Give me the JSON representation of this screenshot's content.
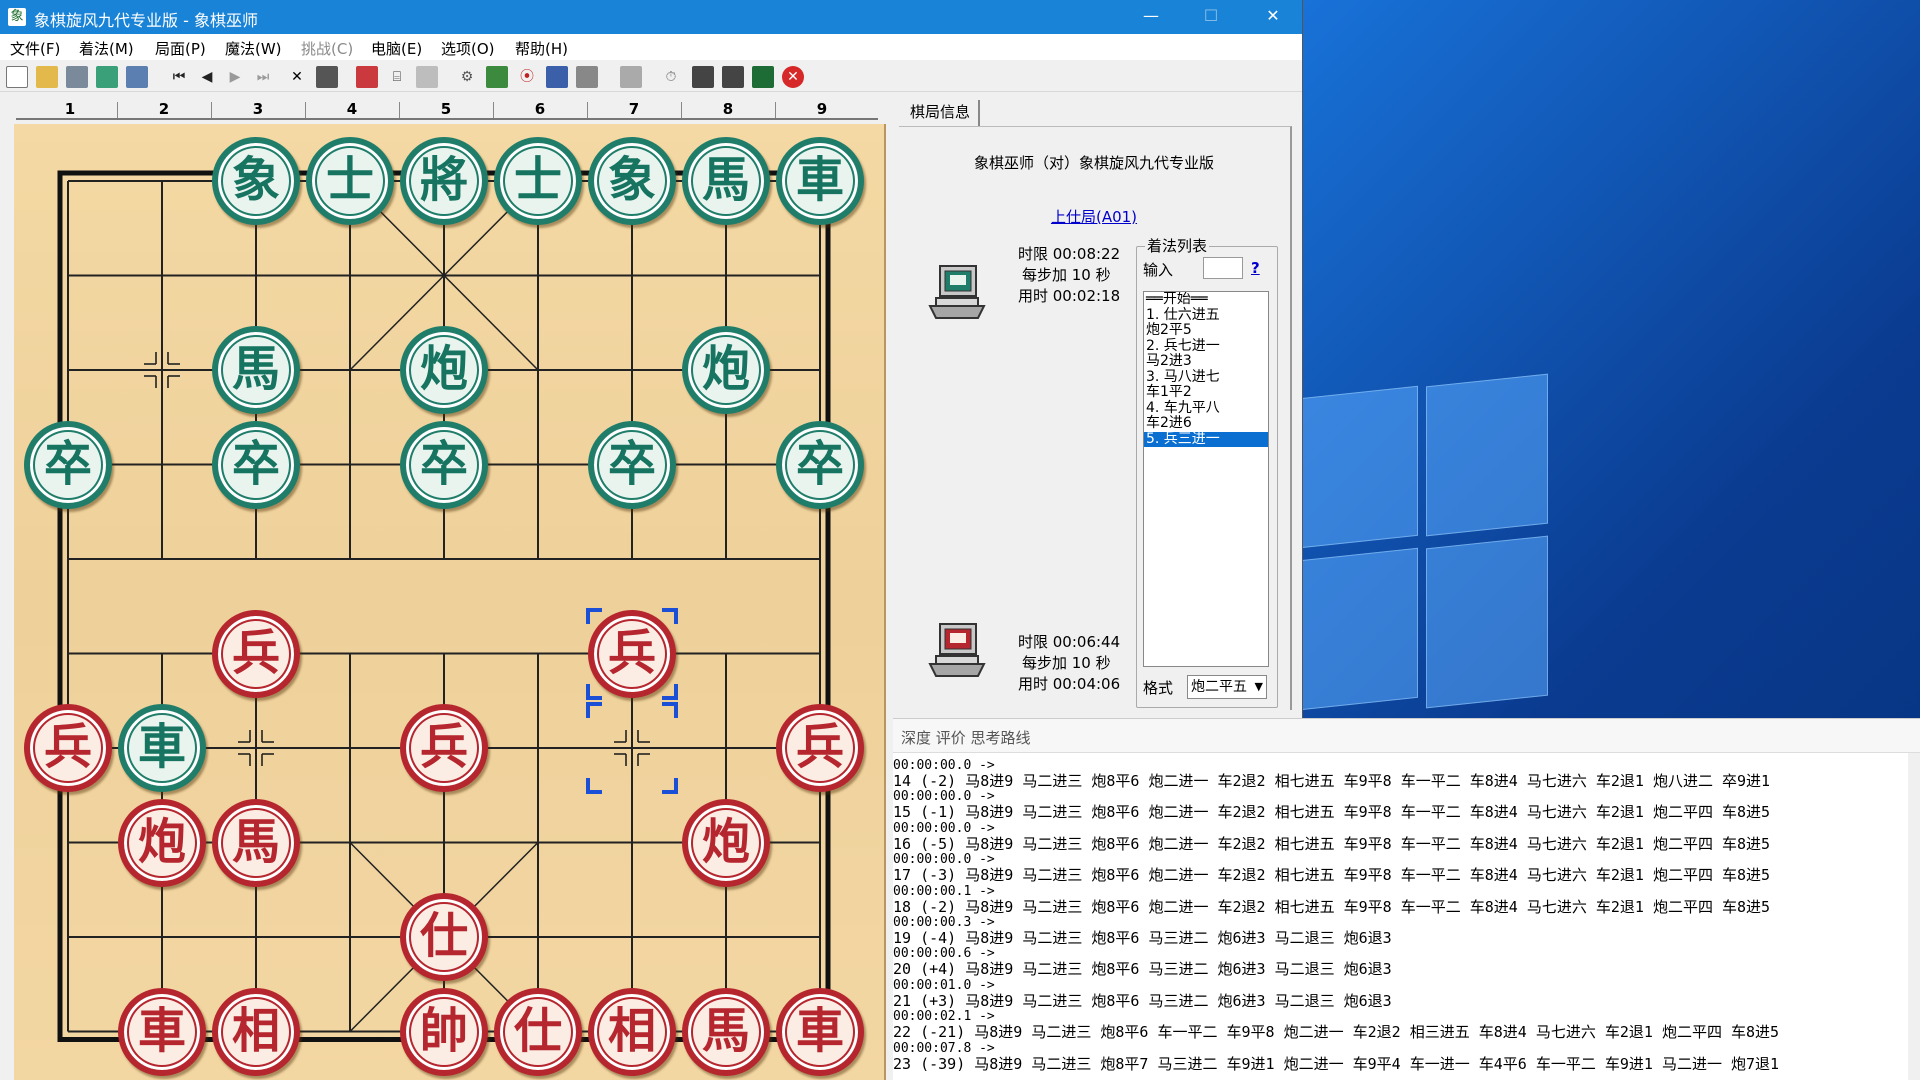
{
  "window": {
    "title": "象棋旋风九代专业版 - 象棋巫师",
    "app_icon_glyph": "象",
    "min_label": "—",
    "max_label": "☐",
    "close_label": "✕"
  },
  "menu": [
    {
      "label": "文件(F)",
      "enabled": true
    },
    {
      "label": "着法(M)",
      "enabled": true
    },
    {
      "label": "局面(P)",
      "enabled": true
    },
    {
      "label": "魔法(W)",
      "enabled": true
    },
    {
      "label": "挑战(C)",
      "enabled": false
    },
    {
      "label": "电脑(E)",
      "enabled": true
    },
    {
      "label": "选项(O)",
      "enabled": true
    },
    {
      "label": "帮助(H)",
      "enabled": true
    }
  ],
  "toolbar_icons": [
    "new-file-icon",
    "open-folder-icon",
    "save-icon",
    "save-as-icon",
    "print-icon",
    "first-move-icon",
    "previous-move-icon",
    "next-move-icon",
    "last-move-icon",
    "delete-move-icon",
    "paste-icon",
    "flip-board-icon",
    "tree-icon",
    "grid-icon",
    "engine-settings-icon",
    "engine-load-icon",
    "analyze-icon",
    "book-icon",
    "batch-icon",
    "library-icon",
    "timer-icon",
    "computer-black-icon",
    "computer-red-icon",
    "chart-icon",
    "stop-icon"
  ],
  "ruler_numbers": [
    "1",
    "2",
    "3",
    "4",
    "5",
    "6",
    "7",
    "8",
    "9"
  ],
  "pieces": [
    {
      "side": "black",
      "char": "象",
      "file": 2,
      "rank": 0
    },
    {
      "side": "black",
      "char": "士",
      "file": 3,
      "rank": 0
    },
    {
      "side": "black",
      "char": "將",
      "file": 4,
      "rank": 0
    },
    {
      "side": "black",
      "char": "士",
      "file": 5,
      "rank": 0
    },
    {
      "side": "black",
      "char": "象",
      "file": 6,
      "rank": 0
    },
    {
      "side": "black",
      "char": "馬",
      "file": 7,
      "rank": 0
    },
    {
      "side": "black",
      "char": "車",
      "file": 8,
      "rank": 0
    },
    {
      "side": "black",
      "char": "馬",
      "file": 2,
      "rank": 2
    },
    {
      "side": "black",
      "char": "炮",
      "file": 4,
      "rank": 2
    },
    {
      "side": "black",
      "char": "炮",
      "file": 7,
      "rank": 2
    },
    {
      "side": "black",
      "char": "卒",
      "file": 0,
      "rank": 3
    },
    {
      "side": "black",
      "char": "卒",
      "file": 2,
      "rank": 3
    },
    {
      "side": "black",
      "char": "卒",
      "file": 4,
      "rank": 3
    },
    {
      "side": "black",
      "char": "卒",
      "file": 6,
      "rank": 3
    },
    {
      "side": "black",
      "char": "卒",
      "file": 8,
      "rank": 3
    },
    {
      "side": "black",
      "char": "車",
      "file": 1,
      "rank": 6
    },
    {
      "side": "red",
      "char": "兵",
      "file": 2,
      "rank": 5
    },
    {
      "side": "red",
      "char": "兵",
      "file": 6,
      "rank": 5
    },
    {
      "side": "red",
      "char": "兵",
      "file": 0,
      "rank": 6
    },
    {
      "side": "red",
      "char": "兵",
      "file": 4,
      "rank": 6
    },
    {
      "side": "red",
      "char": "兵",
      "file": 8,
      "rank": 6
    },
    {
      "side": "red",
      "char": "炮",
      "file": 1,
      "rank": 7
    },
    {
      "side": "red",
      "char": "馬",
      "file": 2,
      "rank": 7
    },
    {
      "side": "red",
      "char": "炮",
      "file": 7,
      "rank": 7
    },
    {
      "side": "red",
      "char": "仕",
      "file": 4,
      "rank": 8
    },
    {
      "side": "red",
      "char": "車",
      "file": 1,
      "rank": 9
    },
    {
      "side": "red",
      "char": "相",
      "file": 2,
      "rank": 9
    },
    {
      "side": "red",
      "char": "帥",
      "file": 4,
      "rank": 9
    },
    {
      "side": "red",
      "char": "仕",
      "file": 5,
      "rank": 9
    },
    {
      "side": "red",
      "char": "相",
      "file": 6,
      "rank": 9
    },
    {
      "side": "red",
      "char": "馬",
      "file": 7,
      "rank": 9
    },
    {
      "side": "red",
      "char": "車",
      "file": 8,
      "rank": 9
    }
  ],
  "last_move": {
    "from": {
      "file": 6,
      "rank": 6
    },
    "to": {
      "file": 6,
      "rank": 5
    }
  },
  "info": {
    "tab_label": "棋局信息",
    "match_title": "象棋巫师（对）象棋旋风九代专业版",
    "opening": "上仕局(A01)",
    "black_clock": {
      "limit": "时限  00:08:22",
      "increment": "每步加  10  秒",
      "used": "用时  00:02:18"
    },
    "red_clock": {
      "limit": "时限  00:06:44",
      "increment": "每步加  10  秒",
      "used": "用时  00:04:06"
    },
    "movelist_title": "着法列表",
    "input_label": "输入",
    "input_value": "",
    "help_label": "?",
    "moves": [
      "══开始══",
      "1. 仕六进五",
      "   炮2平5",
      "2. 兵七进一",
      "   马2进3",
      "3. 马八进七",
      "   车1平2",
      "4. 车九平八",
      "   车2进6",
      "5. 兵三进一"
    ],
    "selected_move_index": 9,
    "format_label": "格式",
    "format_value": "炮二平五"
  },
  "analysis": {
    "header": "深度  评价  思考路线",
    "lines": [
      {
        "time": "00:00:00.0 ->",
        "main": " 14    (-2) 马8进9  马二进三  炮8平6  炮二进一  车2退2  相七进五  车9平8  车一平二  车8进4  马七进六  车2退1  炮八进二  卒9进1"
      },
      {
        "time": "00:00:00.0 ->",
        "main": " 15    (-1) 马8进9  马二进三  炮8平6  炮二进一  车2退2  相七进五  车9平8  车一平二  车8进4  马七进六  车2退1  炮二平四  车8进5"
      },
      {
        "time": "00:00:00.0 ->",
        "main": " 16    (-5) 马8进9  马二进三  炮8平6  炮二进一  车2退2  相七进五  车9平8  车一平二  车8进4  马七进六  车2退1  炮二平四  车8进5"
      },
      {
        "time": "00:00:00.0 ->",
        "main": " 17    (-3) 马8进9  马二进三  炮8平6  炮二进一  车2退2  相七进五  车9平8  车一平二  车8进4  马七进六  车2退1  炮二平四  车8进5"
      },
      {
        "time": "00:00:00.1 ->",
        "main": " 18    (-2) 马8进9  马二进三  炮8平6  炮二进一  车2退2  相七进五  车9平8  车一平二  车8进4  马七进六  车2退1  炮二平四  车8进5"
      },
      {
        "time": "00:00:00.3 ->",
        "main": " 19    (-4) 马8进9  马二进三  炮8平6  马三进二  炮6进3  马二退三  炮6退3"
      },
      {
        "time": "00:00:00.6 ->",
        "main": " 20    (+4) 马8进9  马二进三  炮8平6  马三进二  炮6进3  马二退三  炮6退3"
      },
      {
        "time": "00:00:01.0 ->",
        "main": " 21    (+3) 马8进9  马二进三  炮8平6  马三进二  炮6进3  马二退三  炮6退3"
      },
      {
        "time": "00:00:02.1 ->",
        "main": " 22   (-21) 马8进9  马二进三  炮8平6  车一平二  车9平8  炮二进一  车2退2  相三进五  车8进4  马七进六  车2退1  炮二平四  车8进5"
      },
      {
        "time": "00:00:07.8 ->",
        "main": " 23   (-39) 马8进9  马二进三  炮8平7  马三进二  车9进1  炮二进一  车9平4  车一进一  车4平6  车一平二  车9进1  马二进一  炮7退1"
      }
    ]
  }
}
